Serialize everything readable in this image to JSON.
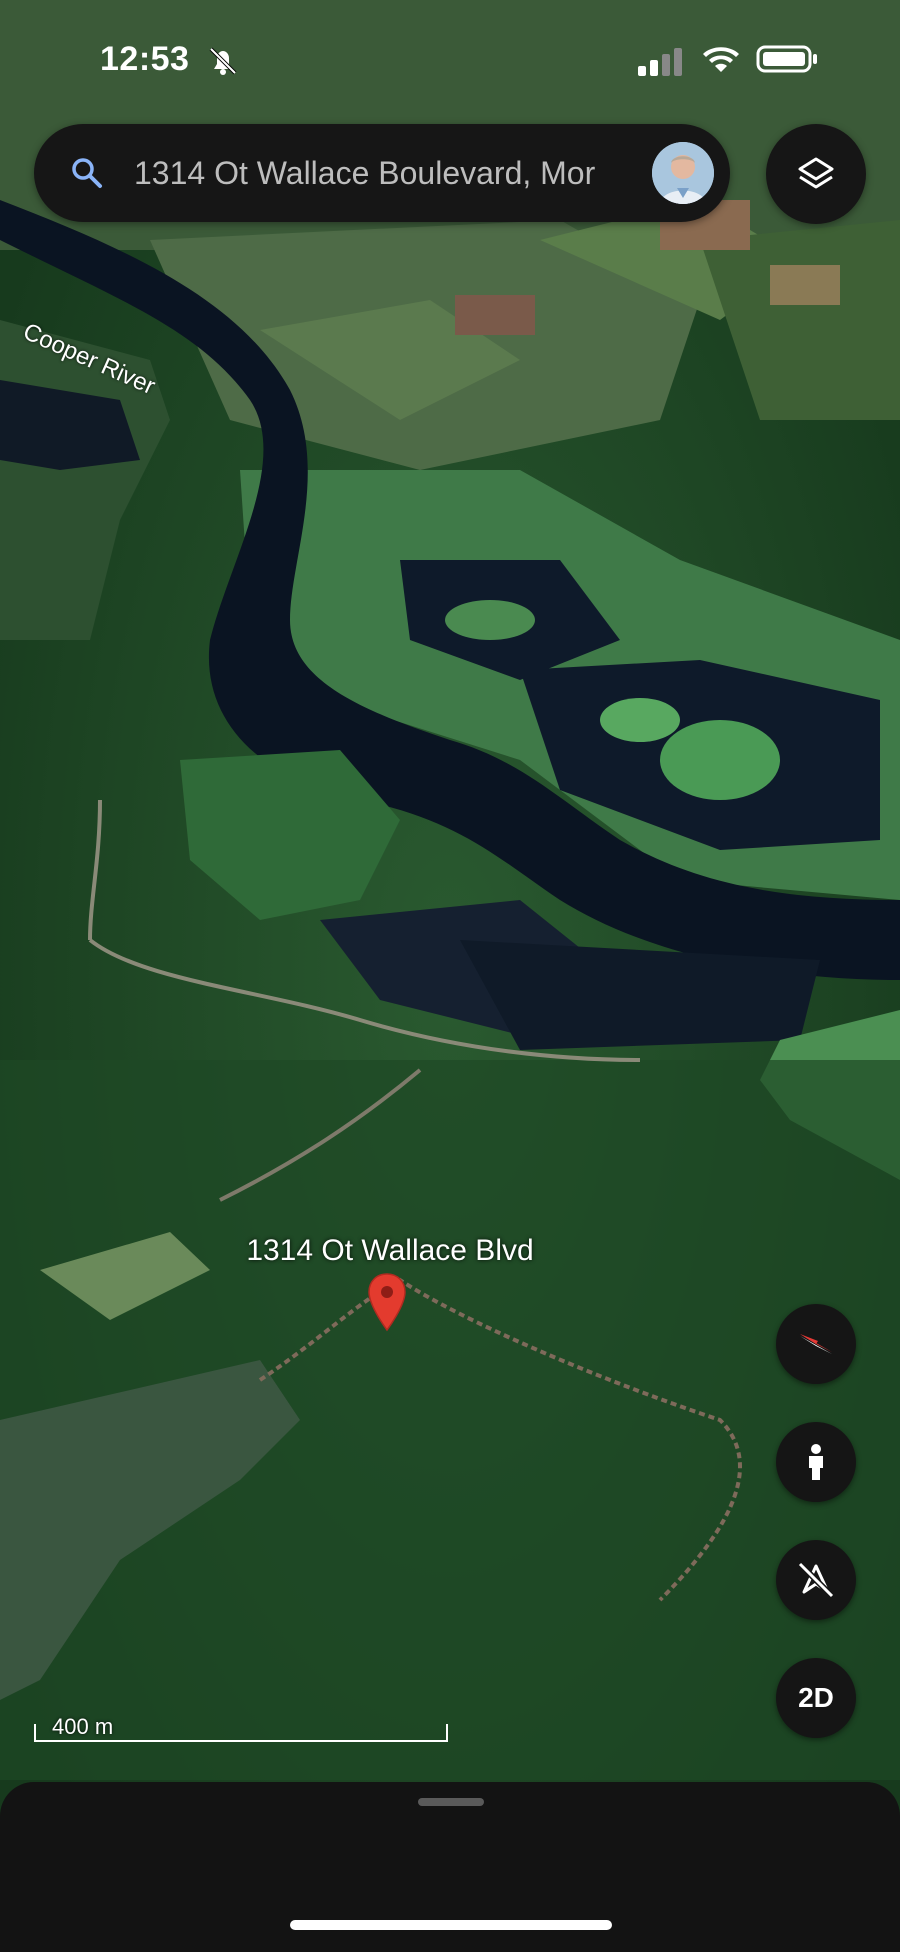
{
  "status_bar": {
    "time": "12:53",
    "icons": [
      "bell-slash-icon",
      "cellular-signal-icon",
      "wifi-icon",
      "battery-icon"
    ]
  },
  "search": {
    "value": "1314 Ot Wallace Boulevard, Mor",
    "icon": "search-icon",
    "avatar": "user-avatar"
  },
  "map": {
    "river_label": "Cooper River",
    "place_label": "1314 Ot Wallace Blvd",
    "scale_label": "400 m"
  },
  "controls": {
    "layers": "layers-icon",
    "compass": "compass-icon",
    "pegman": "pegman-icon",
    "tilt": "tilt-off-icon",
    "mode_label": "2D"
  },
  "colors": {
    "ui_dark": "#161616",
    "pin_red": "#e33b2e",
    "forest": "#1f4a27",
    "river": "#0a1422"
  }
}
